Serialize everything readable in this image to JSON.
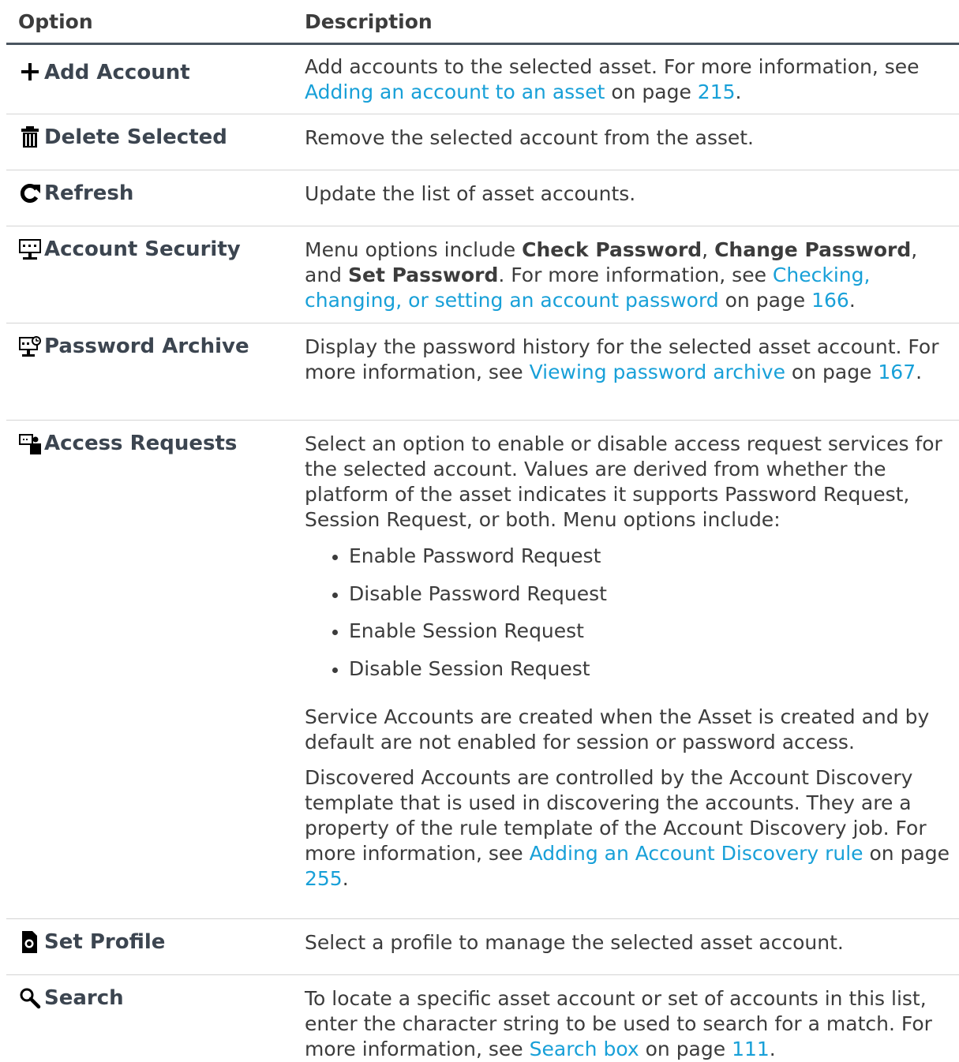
{
  "header": {
    "option": "Option",
    "description": "Description"
  },
  "rows": [
    {
      "label": "Add Account",
      "icon": "plus-icon",
      "text": "Add accounts to the selected asset. For more information, see ",
      "link": "Adding an account to an asset",
      "mid": " on page ",
      "page": "215",
      "end": "."
    },
    {
      "label": "Delete Selected",
      "icon": "trash-icon",
      "text": "Remove the selected account from the asset."
    },
    {
      "label": "Refresh",
      "icon": "refresh-icon",
      "text": "Update the list of asset accounts."
    },
    {
      "label": "Account Security",
      "icon": "monitor-password-icon",
      "t1": "Menu options include ",
      "b1": "Check Password",
      "t2": ", ",
      "b2": "Change Password",
      "t3": ", and ",
      "b3": "Set Password",
      "t4": ". For more information, see ",
      "link": "Checking, changing, or setting an account password",
      "mid": " on page ",
      "page": "166",
      "end": "."
    },
    {
      "label": "Password Archive",
      "icon": "monitor-archive-icon",
      "text": "Display the password history for the selected asset account. For more information, see ",
      "link": "Viewing password archive",
      "mid": " on page ",
      "page": "167",
      "end": "."
    },
    {
      "label": "Access Requests",
      "icon": "access-request-icon",
      "p1": "Select an option to enable or disable access request services for the selected account. Values are derived from whether the platform of the asset indicates it supports Password Request, Session Request, or both. Menu options include:",
      "bullets": [
        "Enable Password Request",
        "Disable Password Request",
        "Enable Session Request",
        "Disable Session Request"
      ],
      "p2": "Service Accounts are created when the Asset is created and by default are not enabled for session or password access.",
      "p3": "Discovered Accounts are controlled by the Account Discovery template that is used in discovering the accounts. They are a property of the rule template of the Account Discovery job. For more information, see ",
      "link": "Adding an Account Discovery rule",
      "mid": " on page ",
      "page": "255",
      "end": "."
    },
    {
      "label": "Set Profile",
      "icon": "profile-icon",
      "text": "Select a profile to manage the selected asset account."
    },
    {
      "label": "Search",
      "icon": "search-icon",
      "text": "To locate a specific asset account or set of accounts in this list, enter the character string to be used to search for a match. For more information, see ",
      "link": "Search box",
      "mid": " on page ",
      "page": "111",
      "end": "."
    }
  ]
}
